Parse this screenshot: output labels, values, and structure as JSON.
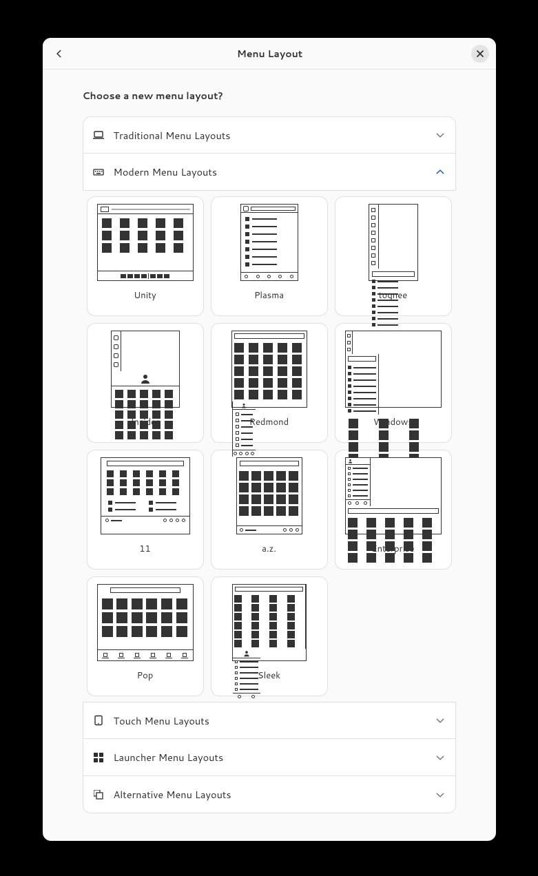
{
  "title": "Menu Layout",
  "heading": "Choose a new menu layout?",
  "sections": {
    "traditional": {
      "label": "Traditional Menu Layouts",
      "expanded": false
    },
    "modern": {
      "label": "Modern Menu Layouts",
      "expanded": true
    },
    "touch": {
      "label": "Touch Menu Layouts",
      "expanded": false
    },
    "launcher": {
      "label": "Launcher Menu Layouts",
      "expanded": false
    },
    "alternative": {
      "label": "Alternative Menu Layouts",
      "expanded": false
    }
  },
  "modern_layouts": [
    {
      "id": "unity",
      "label": "Unity"
    },
    {
      "id": "plasma",
      "label": "Plasma"
    },
    {
      "id": "tognee",
      "label": "tognee"
    },
    {
      "id": "insider",
      "label": "Insider"
    },
    {
      "id": "redmond",
      "label": "Redmond"
    },
    {
      "id": "windows",
      "label": "Windows"
    },
    {
      "id": "eleven",
      "label": "11"
    },
    {
      "id": "az",
      "label": "a.z."
    },
    {
      "id": "enterprise",
      "label": "Enterprise"
    },
    {
      "id": "pop",
      "label": "Pop"
    },
    {
      "id": "sleek",
      "label": "Sleek"
    }
  ]
}
